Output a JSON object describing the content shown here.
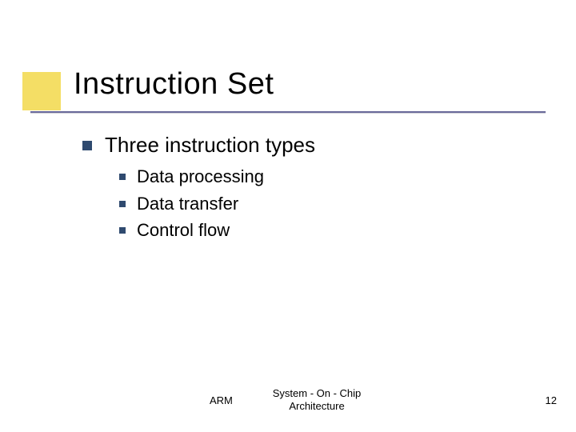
{
  "title": "Instruction Set",
  "level1": "Three instruction types",
  "sub": {
    "0": "Data processing",
    "1": "Data transfer",
    "2": "Control flow"
  },
  "footer": {
    "left": "ARM",
    "center": "System - On - Chip Architecture",
    "page": "12"
  },
  "colors": {
    "accent": "#f2d84a",
    "bullet": "#2f4a6f",
    "rule": "#6a6a9a"
  }
}
